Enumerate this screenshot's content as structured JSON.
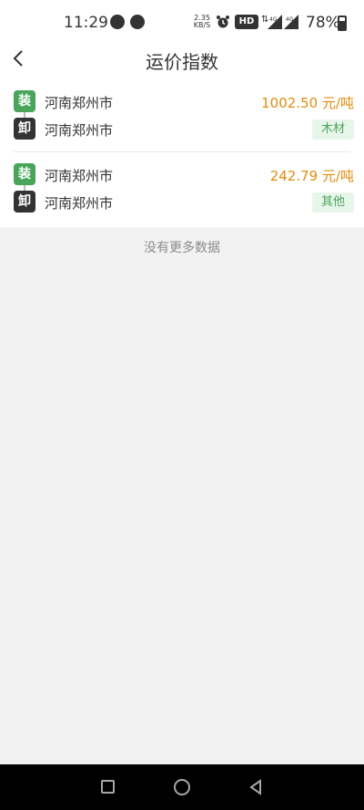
{
  "status_bar": {
    "time": "11:29",
    "speed": "2.35\nKB/S",
    "hd": "HD",
    "network_1": "4G",
    "network_2": "4G",
    "battery": "78%"
  },
  "header": {
    "title": "运价指数"
  },
  "items": [
    {
      "load_tag": "装",
      "unload_tag": "卸",
      "load_location": "河南郑州市",
      "unload_location": "河南郑州市",
      "price": "1002.50 元/吨",
      "cargo": "木材"
    },
    {
      "load_tag": "装",
      "unload_tag": "卸",
      "load_location": "河南郑州市",
      "unload_location": "河南郑州市",
      "price": "242.79 元/吨",
      "cargo": "其他"
    }
  ],
  "footer_text": "没有更多数据",
  "icons": {
    "status_left_1": "chat-bubble-icon",
    "status_left_2": "app-icon",
    "alarm": "alarm-clock-icon",
    "signal": "signal-icon",
    "battery": "battery-icon",
    "back": "chevron-left-icon",
    "nav_recents": "square-icon",
    "nav_home": "circle-icon",
    "nav_back": "triangle-back-icon"
  },
  "colors": {
    "green": "#48a55b",
    "orange": "#e18c0e",
    "dark": "#333333",
    "light_gray": "#f2f2f2"
  }
}
